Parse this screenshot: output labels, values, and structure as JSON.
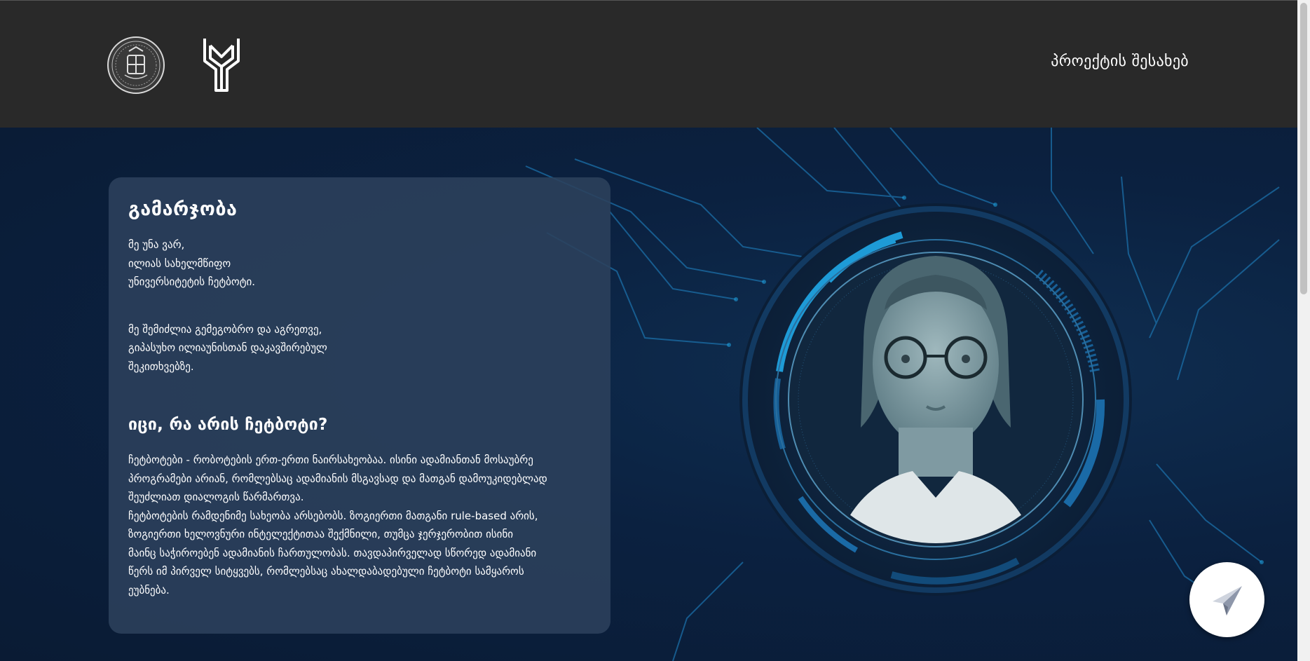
{
  "header": {
    "nav_about": "პროექტის შესახებ",
    "seal_icon": "university-seal-icon",
    "mark_icon": "university-mark-icon"
  },
  "card": {
    "greeting_title": "გამარჯობა",
    "intro_lines": [
      "მე უნა ვარ,",
      "ილიას სახელმწიფო",
      "უნივერსიტეტის ჩეტბოტი."
    ],
    "ability_lines": [
      "მე შემიძლია გემეგობრო და აგრეთვე,",
      "გიპასუხო ილიაუნისთან დაკავშირებულ",
      "შეკითხვებზე."
    ],
    "question_title": "იცი, რა არის ჩეტბოტი?",
    "body_lines": [
      "ჩეტბოტები - რობოტების ერთ-ერთი ნაირსახეობაა. ისინი ადამიანთან მოსაუბრე",
      "პროგრამები არიან, რომლებსაც ადამიანის მსგავსად და მათგან დამოუკიდებლად",
      "შეუძლიათ დიალოგის წარმართვა.",
      "ჩეტბოტების რამდენიმე სახეობა არსებობს. ზოგიერთი მათგანი rule-based არის,",
      "ზოგიერთი ხელოვნური ინტელექტითაა შექმნილი, თუმცა ჯერჯერობით ისინი",
      "მაინც საჭიროებენ ადამიანის ჩართულობას. თავდაპირველად სწორედ ადამიანი",
      "წერს იმ პირველ სიტყვებს, რომლებსაც ახალდაბადებული ჩეტბოტი სამყაროს",
      "ეუბნება."
    ]
  },
  "avatar": {
    "icon": "chatbot-avatar-icon"
  },
  "send_button": {
    "icon": "paper-plane-icon"
  },
  "colors": {
    "header_bg": "#292929",
    "hero_bg": "#0c1d36",
    "card_bg": "#2c415c",
    "accent": "#1e9bd7"
  }
}
